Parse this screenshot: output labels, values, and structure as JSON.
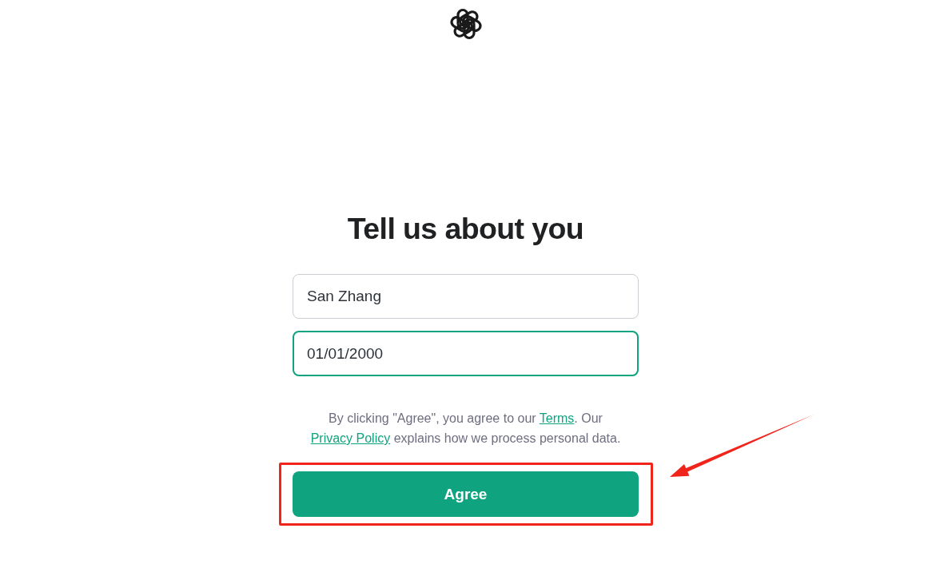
{
  "heading": "Tell us about you",
  "fields": [
    {
      "value": "San Zhang",
      "focused": false
    },
    {
      "value": "01/01/2000",
      "focused": true
    }
  ],
  "consent_text": [
    {
      "kind": "text",
      "text": "By clicking \"Agree\", you agree to our "
    },
    {
      "kind": "link",
      "text": "Terms"
    },
    {
      "kind": "text",
      "text": ". Our "
    },
    {
      "kind": "link",
      "text": "Privacy Policy"
    },
    {
      "kind": "text",
      "text": " explains how we process personal data."
    }
  ],
  "primary_button": {
    "label": "Agree"
  },
  "annotations": {
    "highlight_box": true,
    "arrow": true
  }
}
